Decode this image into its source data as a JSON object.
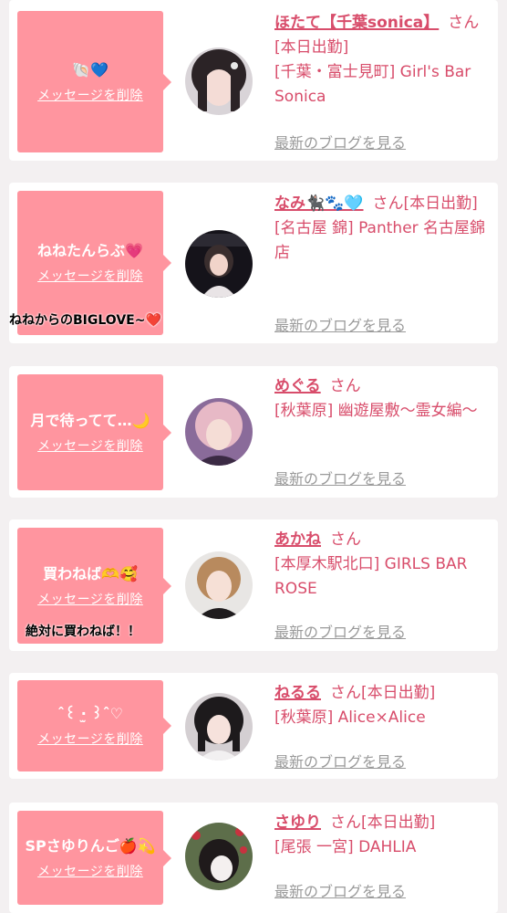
{
  "common": {
    "delete_label": "メッセージを削除",
    "blog_label": "最新のブログを見る",
    "san": "さん"
  },
  "colors": {
    "bubble": "#ff959f",
    "accent": "#d84d6b",
    "muted": "#9a9a9a"
  },
  "entries": [
    {
      "message": "🐚💙",
      "name": "ほたて【千葉sonica】",
      "status": "[本日出勤]",
      "shop": "[千葉・富士見町] Girl's Bar Sonica",
      "sticker": ""
    },
    {
      "message": "ねねたんらぶ💗",
      "name": "なみ🐈‍⬛🐾🩵",
      "status": "[本日出勤]",
      "shop": "[名古屋 錦] Panther 名古屋錦店",
      "sticker": "ねねからのBIGLOVE~❤️"
    },
    {
      "message": "月で待ってて…🌙",
      "name": "めぐる",
      "status": "",
      "shop": "[秋葉原] 幽遊屋敷〜霊女編〜",
      "sticker": ""
    },
    {
      "message": "買わねば🫶🥰",
      "name": "あかね",
      "status": "",
      "shop": "[本厚木駅北口] GIRLS BAR ROSE",
      "sticker": "絶対に買わねば！！"
    },
    {
      "message": "ˆ꒰ ‧̫ ꒱ˆ♡",
      "name": "ねるる",
      "status": "[本日出勤]",
      "shop": "[秋葉原] Alice×Alice",
      "sticker": ""
    },
    {
      "message": "SPさゆりんご🍎💫",
      "name": "さゆり",
      "status": "[本日出勤]",
      "shop": "[尾張 一宮] DAHLIA",
      "sticker": ""
    }
  ]
}
